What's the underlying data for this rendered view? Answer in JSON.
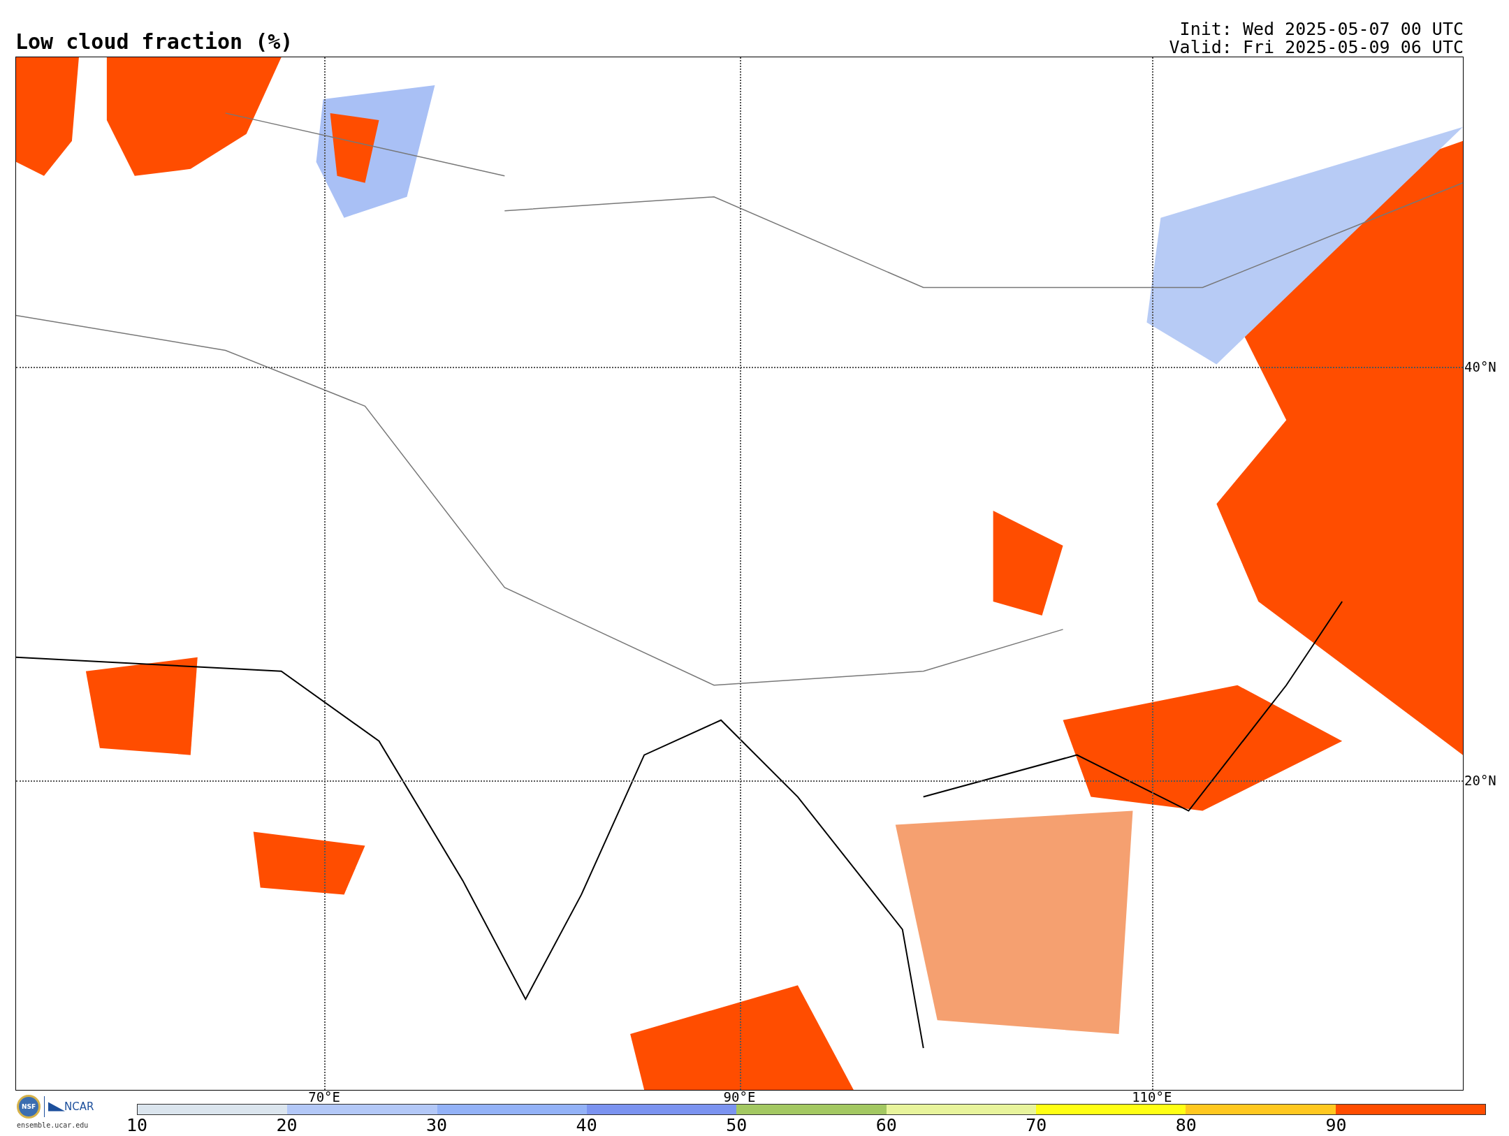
{
  "title": "Low cloud fraction (%)",
  "run_info": [
    "Init: Wed 2025-05-07 00 UTC",
    "Valid: Fri 2025-05-09 06 UTC"
  ],
  "map": {
    "lat_labels": [
      "40°N",
      "20°N"
    ],
    "lon_labels": [
      "70°E",
      "90°E",
      "110°E"
    ]
  },
  "logo": {
    "seal": "NSF",
    "name": "NCAR",
    "url": "ensemble.ucar.edu"
  },
  "colorbar": {
    "bins": [
      {
        "color": "#dbe5ee"
      },
      {
        "color": "#b3c8f7"
      },
      {
        "color": "#93b2f7"
      },
      {
        "color": "#7b93f0"
      },
      {
        "color": "#a3c862"
      },
      {
        "color": "#e8f49c"
      },
      {
        "color": "#ffff14"
      },
      {
        "color": "#ffc820"
      },
      {
        "color": "#ff4d00"
      }
    ],
    "ticks": [
      "10",
      "20",
      "30",
      "40",
      "50",
      "60",
      "70",
      "80",
      "90"
    ]
  }
}
